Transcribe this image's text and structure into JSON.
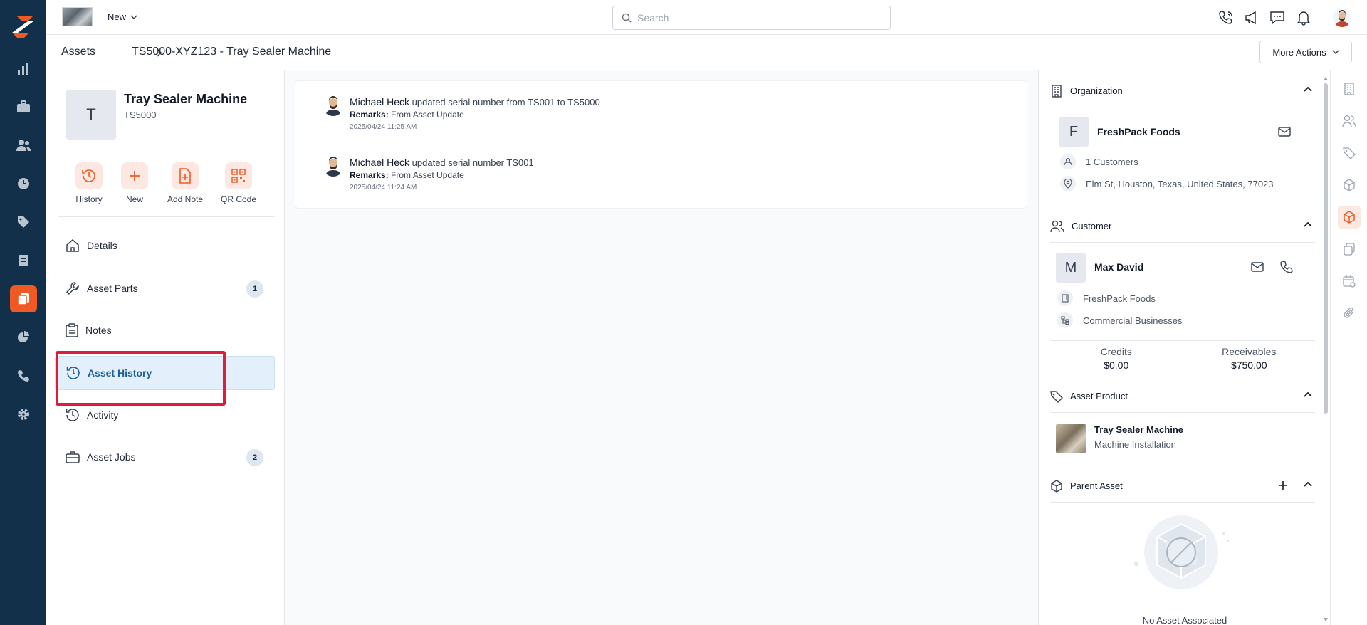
{
  "topbar": {
    "new_label": "New",
    "search_placeholder": "Search"
  },
  "breadcrumb": {
    "root": "Assets",
    "current": "TS5000-XYZ123 - Tray Sealer Machine",
    "more_actions": "More Actions"
  },
  "asset": {
    "initial": "T",
    "title": "Tray Sealer Machine",
    "code": "TS5000"
  },
  "quick_actions": [
    {
      "label": "History",
      "icon": "history-icon"
    },
    {
      "label": "New",
      "icon": "plus-icon"
    },
    {
      "label": "Add Note",
      "icon": "add-note-icon"
    },
    {
      "label": "QR Code",
      "icon": "qr-code-icon"
    }
  ],
  "menu": [
    {
      "label": "Details",
      "icon": "home-icon",
      "badge": null
    },
    {
      "label": "Asset Parts",
      "icon": "wrench-icon",
      "badge": "1"
    },
    {
      "label": "Notes",
      "icon": "clipboard-icon",
      "badge": null
    },
    {
      "label": "Asset History",
      "icon": "history-icon",
      "badge": null,
      "active": true
    },
    {
      "label": "Activity",
      "icon": "activity-icon",
      "badge": null
    },
    {
      "label": "Asset Jobs",
      "icon": "briefcase-icon",
      "badge": "2"
    }
  ],
  "history": [
    {
      "user": "Michael Heck",
      "action": "updated serial number from TS001 to TS5000",
      "remarks_label": "Remarks:",
      "remarks": "From Asset Update",
      "timestamp": "2025/04/24 11:25 AM"
    },
    {
      "user": "Michael Heck",
      "action": "updated serial number TS001",
      "remarks_label": "Remarks:",
      "remarks": "From Asset Update",
      "timestamp": "2025/04/24 11:24 AM"
    }
  ],
  "organization": {
    "heading": "Organization",
    "initial": "F",
    "name": "FreshPack Foods",
    "customers": "1 Customers",
    "address": "Elm St, Houston, Texas, United States, 77023"
  },
  "customer": {
    "heading": "Customer",
    "initial": "M",
    "name": "Max David",
    "organization": "FreshPack Foods",
    "type": "Commercial Businesses",
    "credits_label": "Credits",
    "credits_value": "$0.00",
    "receivables_label": "Receivables",
    "receivables_value": "$750.00"
  },
  "asset_product": {
    "heading": "Asset Product",
    "name": "Tray Sealer Machine",
    "category": "Machine Installation"
  },
  "parent_asset": {
    "heading": "Parent Asset",
    "empty_text": "No Asset Associated"
  },
  "colors": {
    "nav_bg": "#12304a",
    "accent": "#ef5a24",
    "active_menu_bg": "#e3f0fb",
    "highlight": "#e01b3c"
  }
}
